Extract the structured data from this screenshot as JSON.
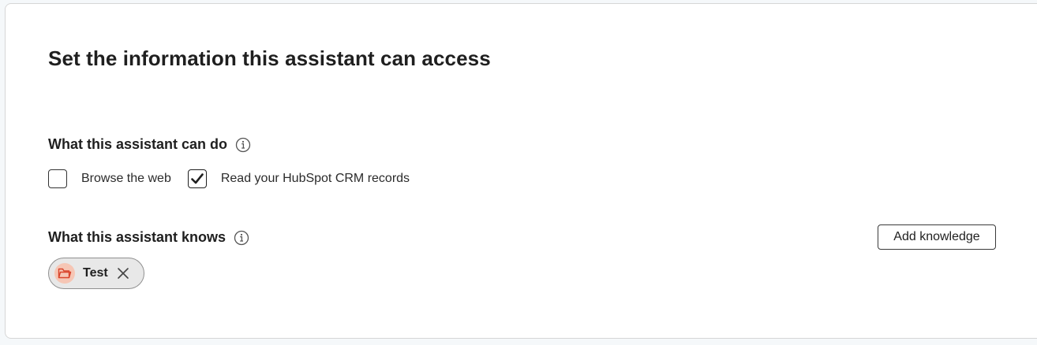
{
  "page": {
    "title": "Set the information this assistant can access"
  },
  "capabilities": {
    "heading": "What this assistant can do",
    "options": [
      {
        "label": "Browse the web",
        "checked": false
      },
      {
        "label": "Read your HubSpot CRM records",
        "checked": true
      }
    ]
  },
  "knowledge": {
    "heading": "What this assistant knows",
    "add_button_label": "Add knowledge",
    "sources": [
      {
        "label": "Test",
        "icon": "folder-icon"
      }
    ]
  },
  "colors": {
    "chip_avatar_bg": "#f6c6b5",
    "chip_icon": "#d9442b"
  }
}
